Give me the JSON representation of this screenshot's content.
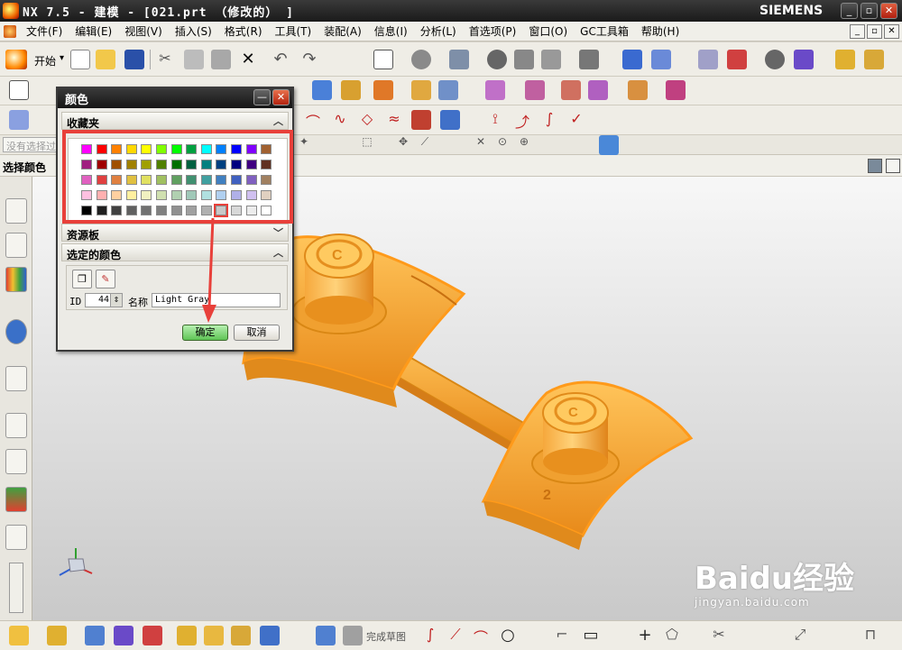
{
  "window": {
    "title": "NX 7.5 - 建模 - [021.prt （修改的） ]",
    "brand": "SIEMENS",
    "minimize_label": "_",
    "restore_label": "▫",
    "close_label": "✕"
  },
  "menu": {
    "items": [
      "文件(F)",
      "编辑(E)",
      "视图(V)",
      "插入(S)",
      "格式(R)",
      "工具(T)",
      "装配(A)",
      "信息(I)",
      "分析(L)",
      "首选项(P)",
      "窗口(O)",
      "GC工具箱",
      "帮助(H)"
    ]
  },
  "toolbar": {
    "start_label": "开始",
    "start_dropdown": "▾"
  },
  "selection_bar": {
    "filter_placeholder": "没有选择过滤器"
  },
  "cue": {
    "label": "选择颜色"
  },
  "dialog": {
    "title": "颜色",
    "favorites_header": "收藏夹",
    "palette_header": "资源板",
    "selected_header": "选定的颜色",
    "id_label": "ID",
    "id_value": "44",
    "name_label": "名称",
    "name_value": "Light Gray",
    "ok_label": "确定",
    "cancel_label": "取消"
  },
  "bottom_toolbar": {
    "finish_sketch_label": "完成草图"
  },
  "watermark": {
    "line1": "Baidu经验",
    "line2": "jingyan.baidu.com"
  },
  "palette_colors": [
    [
      "#ff00ff",
      "#ff0000",
      "#ff8000",
      "#ffd800",
      "#ffff00",
      "#80ff00",
      "#00ff00",
      "#00a040",
      "#00ffff",
      "#0080ff",
      "#0000ff",
      "#8000ff",
      "#a06030"
    ],
    [
      "#a02080",
      "#a00000",
      "#a05000",
      "#a08000",
      "#a0a000",
      "#508000",
      "#007000",
      "#006040",
      "#008080",
      "#004080",
      "#000080",
      "#400080",
      "#603020"
    ],
    [
      "#e060c0",
      "#e04040",
      "#e08040",
      "#e0c040",
      "#e0e060",
      "#a0c060",
      "#60a060",
      "#409070",
      "#40a0a0",
      "#4080c0",
      "#4060c0",
      "#8060c0",
      "#a08060"
    ],
    [
      "#ffc0e0",
      "#ffb0b0",
      "#ffd0a0",
      "#fff0a0",
      "#f0f0c0",
      "#d0e0b0",
      "#b0d0b0",
      "#a0c8b8",
      "#b0e0e0",
      "#b0d0f0",
      "#b0b0e8",
      "#d0c0f0",
      "#e0d0c0"
    ],
    [
      "#000000",
      "#202020",
      "#404040",
      "#606060",
      "#707070",
      "#808080",
      "#909090",
      "#a0a0a0",
      "#b0b0b0",
      "#c8c8c8",
      "#d8d8d8",
      "#ececec",
      "#ffffff"
    ]
  ],
  "colors": {
    "model": "#f5a93a",
    "model_edge": "#d98714",
    "highlight": "#e8403a"
  }
}
